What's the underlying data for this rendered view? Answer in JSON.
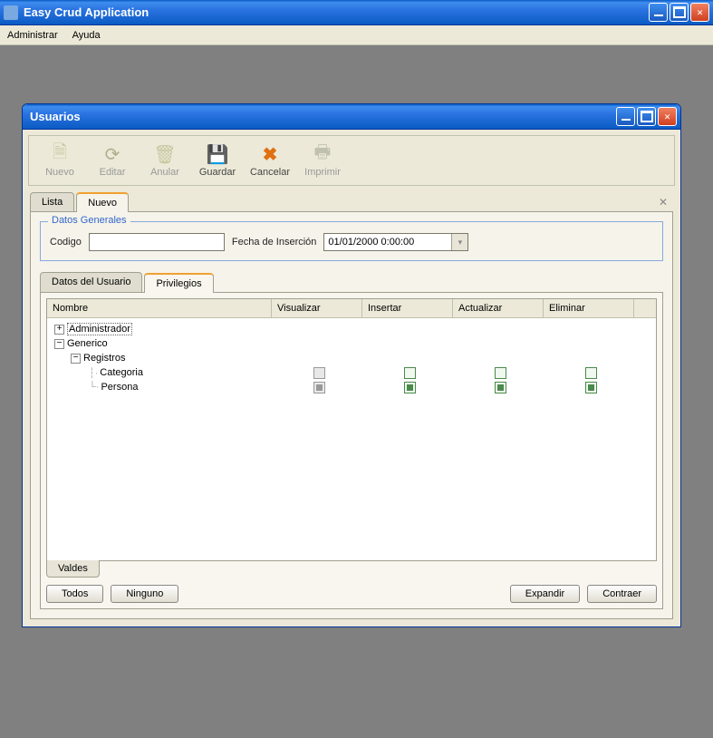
{
  "app": {
    "title": "Easy Crud Application"
  },
  "menu": {
    "items": [
      "Administrar",
      "Ayuda"
    ]
  },
  "child": {
    "title": "Usuarios"
  },
  "toolbar": {
    "nuevo": "Nuevo",
    "editar": "Editar",
    "anular": "Anular",
    "guardar": "Guardar",
    "cancelar": "Cancelar",
    "imprimir": "Imprimir"
  },
  "tabs": {
    "lista": "Lista",
    "nuevo": "Nuevo"
  },
  "general": {
    "legend": "Datos Generales",
    "codigo_label": "Codigo",
    "codigo_value": "",
    "fecha_label": "Fecha de Inserción",
    "fecha_value": "01/01/2000 0:00:00"
  },
  "inner_tabs": {
    "datos_usuario": "Datos del Usuario",
    "privilegios": "Privilegios"
  },
  "grid": {
    "headers": {
      "nombre": "Nombre",
      "visualizar": "Visualizar",
      "insertar": "Insertar",
      "actualizar": "Actualizar",
      "eliminar": "Eliminar"
    },
    "rows": {
      "administrador": "Administrador",
      "generico": "Generico",
      "registros": "Registros",
      "categoria": "Categoria",
      "persona": "Persona"
    }
  },
  "valdes_tab": "Valdes",
  "buttons": {
    "todos": "Todos",
    "ninguno": "Ninguno",
    "expandir": "Expandir",
    "contraer": "Contraer"
  }
}
